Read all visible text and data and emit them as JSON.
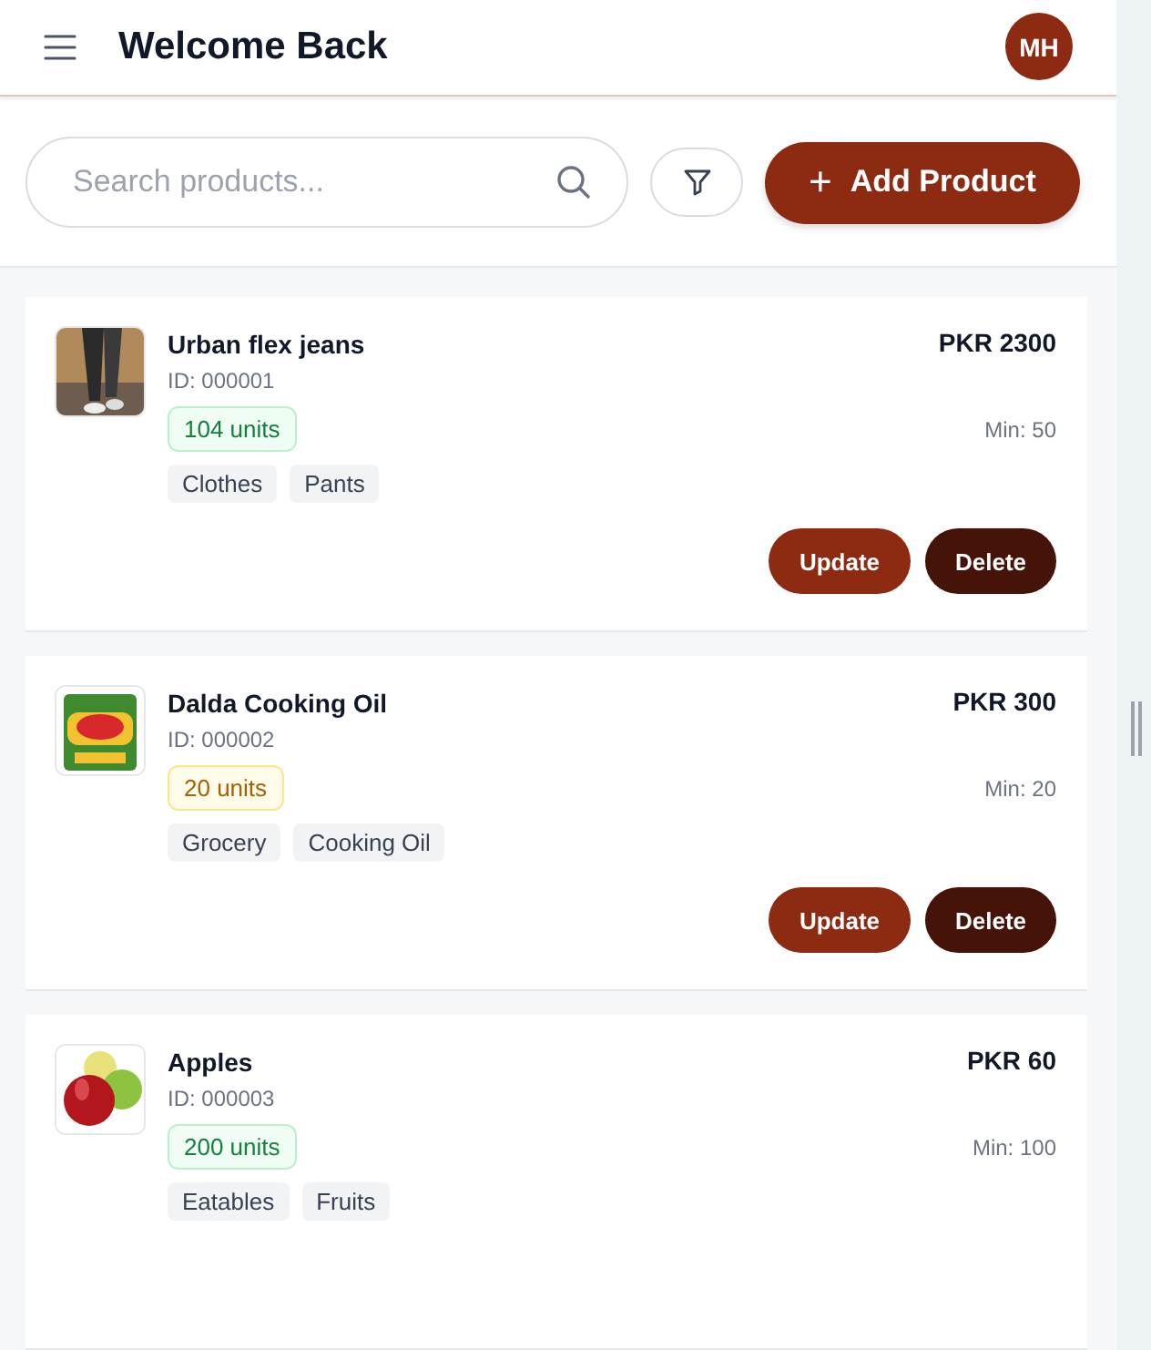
{
  "header": {
    "title": "Welcome Back",
    "avatar": "MH"
  },
  "search": {
    "placeholder": "Search products..."
  },
  "add_button": {
    "icon": "+",
    "label": "Add Product"
  },
  "products": [
    {
      "name": "Urban flex jeans",
      "id": "ID: 000001",
      "price": "PKR 2300",
      "stock": {
        "text": "104 units",
        "kind": "ok"
      },
      "min": "Min: 50",
      "tags": [
        "Clothes",
        "Pants"
      ],
      "buttons": [
        "Update",
        "Delete"
      ]
    },
    {
      "name": "Dalda Cooking Oil",
      "id": "ID: 000002",
      "price": "PKR 300",
      "stock": {
        "text": "20 units",
        "kind": "low"
      },
      "min": "Min: 20",
      "tags": [
        "Grocery",
        "Cooking Oil"
      ],
      "buttons": [
        "Update",
        "Delete"
      ]
    },
    {
      "name": "Apples",
      "id": "ID: 000003",
      "price": "PKR 60",
      "stock": {
        "text": "200 units",
        "kind": "ok"
      },
      "min": "Min: 100",
      "tags": [
        "Eatables",
        "Fruits"
      ]
    }
  ]
}
